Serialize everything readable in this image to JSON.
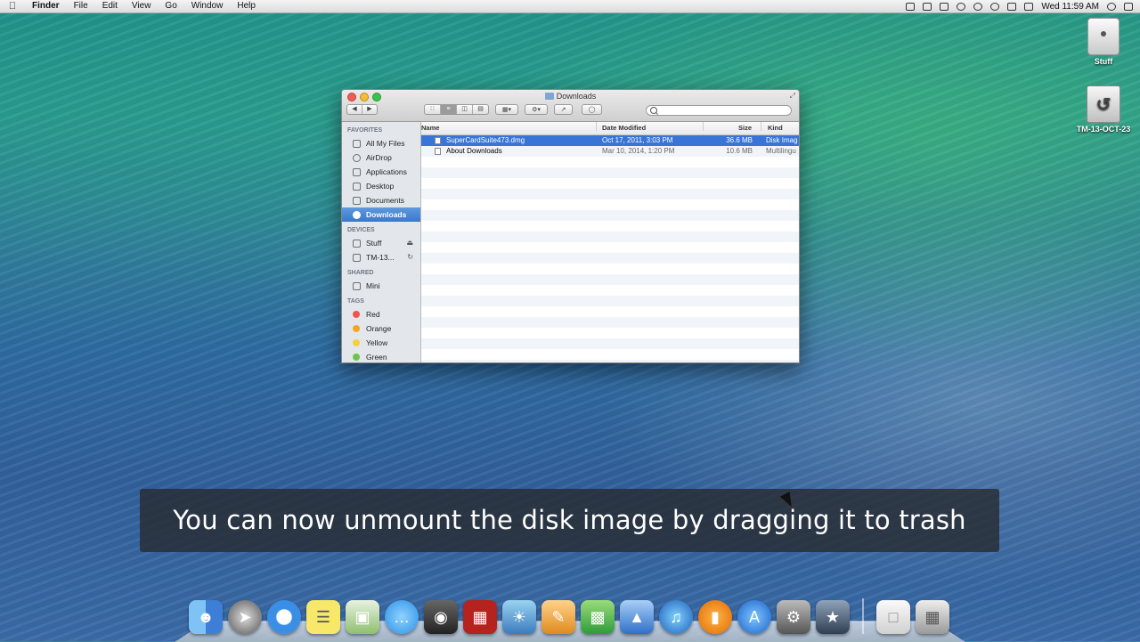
{
  "menubar": {
    "apple_icon": "apple-icon",
    "items": [
      "Finder",
      "File",
      "Edit",
      "View",
      "Go",
      "Window",
      "Help"
    ],
    "clock": "Wed 11:59 AM"
  },
  "desktop_icons": [
    {
      "label": "Stuff",
      "icon": "hard-drive-icon"
    },
    {
      "label": "TM-13-OCT-23",
      "icon": "time-machine-drive-icon"
    }
  ],
  "window": {
    "title": "Downloads",
    "sidebar": {
      "favorites_header": "FAVORITES",
      "favorites": [
        "All My Files",
        "AirDrop",
        "Applications",
        "Desktop",
        "Documents",
        "Downloads"
      ],
      "devices_header": "DEVICES",
      "devices": [
        "Stuff",
        "TM-13..."
      ],
      "shared_header": "SHARED",
      "shared": [
        "Mini"
      ],
      "tags_header": "TAGS",
      "tags": [
        {
          "label": "Red",
          "color": "#f0524f"
        },
        {
          "label": "Orange",
          "color": "#f5a623"
        },
        {
          "label": "Yellow",
          "color": "#f4d03f"
        },
        {
          "label": "Green",
          "color": "#6ac64a"
        }
      ]
    },
    "columns": {
      "name": "Name",
      "date": "Date Modified",
      "size": "Size",
      "kind": "Kind"
    },
    "files": [
      {
        "name": "SuperCardSuite473.dmg",
        "date": "Oct 17, 2011, 3:03 PM",
        "size": "36.6 MB",
        "kind": "Disk Imag"
      },
      {
        "name": "About Downloads",
        "date": "Mar 10, 2014, 1:20 PM",
        "size": "10.6 MB",
        "kind": "Multilingu"
      }
    ]
  },
  "caption": "You can now unmount the disk image by dragging it to trash",
  "dock": [
    "Finder",
    "Launchpad",
    "Safari",
    "Stickies",
    "Preview",
    "Messages",
    "FaceTime",
    "Photo Booth",
    "iPhoto",
    "Pages",
    "Numbers",
    "Keynote",
    "iTunes",
    "iBooks",
    "App Store",
    "System Preferences",
    "iMovie",
    "Document",
    "Trash"
  ]
}
